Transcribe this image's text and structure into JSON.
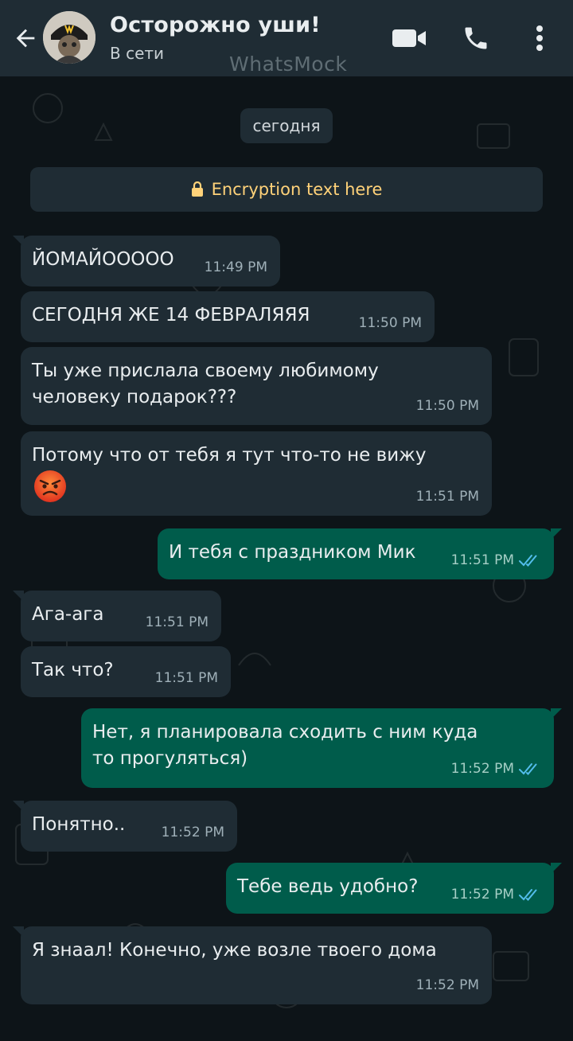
{
  "header": {
    "contact_name": "Осторожно уши!",
    "status": "В сети",
    "watermark": "WhatsMock",
    "icons": [
      "back-arrow-icon",
      "video-call-icon",
      "phone-icon",
      "more-vert-icon"
    ]
  },
  "chat": {
    "date_chip": "сегодня",
    "encryption_text": "Encryption text here",
    "messages": [
      {
        "direction": "in",
        "text": "ЙОМАЙООООО",
        "time": "11:49 PM"
      },
      {
        "direction": "in",
        "text": "СЕГОДНЯ ЖЕ 14 ФЕВРАЛЯЯЯ",
        "time": "11:50 PM"
      },
      {
        "direction": "in",
        "text": "Ты уже прислала своему любимому\nчеловеку подарок???",
        "time": "11:50 PM"
      },
      {
        "direction": "in",
        "text": "Потому что от тебя я тут что-то не вижу",
        "emoji": "angry-face",
        "time": "11:51 PM"
      },
      {
        "direction": "out",
        "text": "И тебя с праздником Мик",
        "time": "11:51 PM",
        "read": true
      },
      {
        "direction": "in",
        "text": "Ага-ага",
        "time": "11:51 PM"
      },
      {
        "direction": "in",
        "text": "Так что?",
        "time": "11:51 PM"
      },
      {
        "direction": "out",
        "text": "Нет, я планировала сходить с ним куда\nто прогуляться)",
        "time": "11:52 PM",
        "read": true
      },
      {
        "direction": "in",
        "text": "Понятно..",
        "time": "11:52 PM"
      },
      {
        "direction": "out",
        "text": "Тебе ведь удобно?",
        "time": "11:52 PM",
        "read": true
      },
      {
        "direction": "in",
        "text": "Я знаал! Конечно, уже возле твоего дома",
        "time": "11:52 PM"
      }
    ]
  },
  "colors": {
    "header_bg": "#1f2c34",
    "incoming_bubble": "#1f2c34",
    "outgoing_bubble": "#005c4b",
    "read_ticks": "#53bdeb",
    "encryption_text": "#ffd279"
  }
}
